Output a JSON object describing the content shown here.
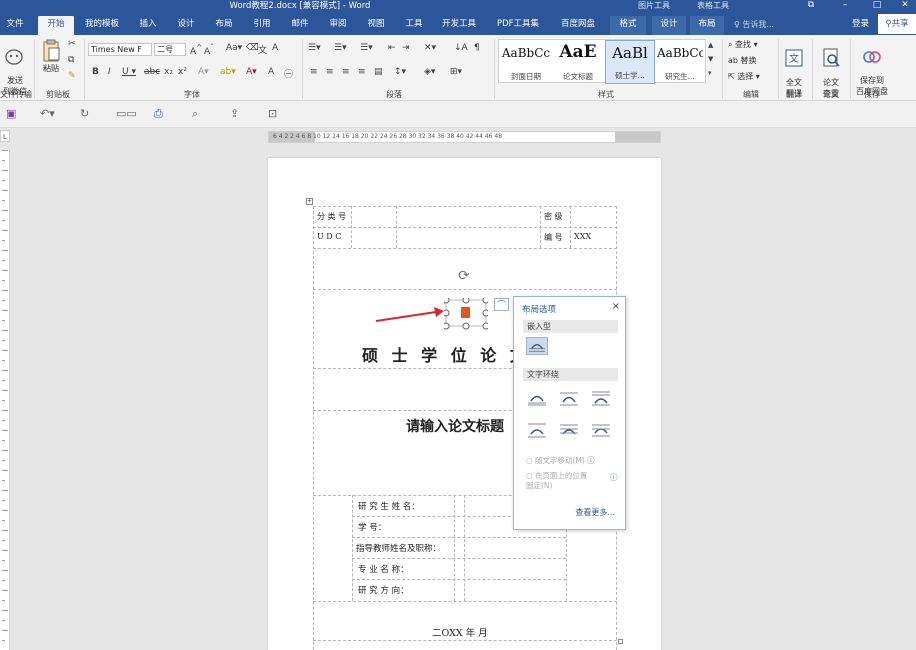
{
  "window": {
    "title": "Word教程2.docx [兼容模式] - Word",
    "context_group_picture": "图片工具",
    "context_group_table": "表格工具",
    "btn_restore": "⧉",
    "btn_minimize": "–",
    "btn_maximize": "□",
    "btn_close": "✕"
  },
  "tabs": [
    "文件",
    "开始",
    "我的模板",
    "插入",
    "设计",
    "布局",
    "引用",
    "邮件",
    "审阅",
    "视图",
    "工具",
    "开发工具",
    "PDF工具集",
    "百度网盘",
    "格式",
    "设计",
    "布局"
  ],
  "active_tab_index": 1,
  "tell_me": "告诉我...",
  "login": "登录",
  "share": "共享",
  "ribbon": {
    "send_weixin": "发送\n到微信",
    "paste": "粘贴",
    "font_name": "Times New F",
    "font_size": "二号",
    "group_labels": {
      "file_transfer": "文件传输",
      "clipboard": "剪贴板",
      "font": "字体",
      "paragraph": "段落",
      "styles": "样式",
      "editing": "编辑",
      "translate": "翻译",
      "thesis": "论文",
      "save": "保存"
    },
    "styles": [
      {
        "preview": "AaBbCc",
        "label": "封面日期"
      },
      {
        "preview": "AaE",
        "label": "论文标题"
      },
      {
        "preview": "AaBl",
        "label": "硕士学..."
      },
      {
        "preview": "AaBbCc",
        "label": "研究生..."
      }
    ],
    "find": "查找",
    "replace": "替换",
    "select": "选择",
    "full_translate": "全文\n翻译",
    "thesis_check": "论文\n查重",
    "save_baidu": "保存到\n百度网盘"
  },
  "ruler_numbers": "6  4  2     2  4  6  8  10  12  14  16  18  20  22  24  26  28  30  32  34  36  38  40  42  44  46  48",
  "document": {
    "classification_no": "分 类 号",
    "secret_level": "密 级",
    "udc": "U D C",
    "number": "编 号",
    "number_value": "XXX",
    "degree_title": "硕  士  学  位  论  文",
    "thesis_title": "请输入论文标题",
    "fields": [
      "研 究 生 姓 名：",
      "学          号：",
      "指导教师姓名及职称：",
      "专  业  名  称：",
      "研  究  方  向："
    ],
    "date": "二OXX 年    月"
  },
  "layout_popup": {
    "title": "布局选项",
    "close": "×",
    "inline_section": "嵌入型",
    "wrap_section": "文字环绕",
    "move_with_text": "随文字移动(M)",
    "fix_position": "在页面上的位置\n固定(N)",
    "see_more": "查看更多..."
  },
  "colors": {
    "accent": "#2b579a",
    "arrow": "#d9262c",
    "office_logo": "#e8541f"
  }
}
